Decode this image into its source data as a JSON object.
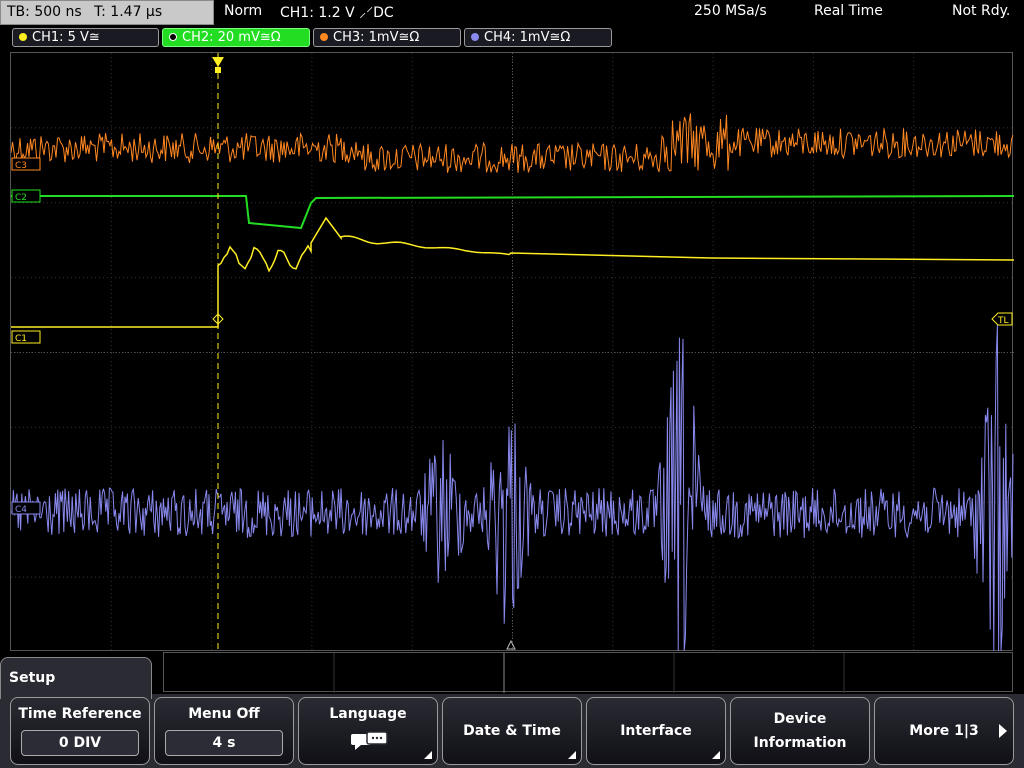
{
  "status": {
    "timebase": "TB: 500 ns",
    "trigger_time": "T: 1.47 µs",
    "mode": "Norm",
    "trigger": "CH1: 1.2 V ⸝⸍DC",
    "sample_rate": "250 MSa/s",
    "acq_mode": "Real Time",
    "state": "Not Rdy."
  },
  "channels": [
    {
      "label": "CH1: 5 V≅",
      "color": "#ffee22"
    },
    {
      "label": "CH2: 20 mV≅Ω",
      "color": "#22dd22"
    },
    {
      "label": "CH3: 1mV≅Ω",
      "color": "#ff8822"
    },
    {
      "label": "CH4: 1mV≅Ω",
      "color": "#8888ee"
    }
  ],
  "markers": {
    "c3": "C3",
    "c2": "C2",
    "c1": "C1",
    "c4": "C4",
    "trigger_level": "TL"
  },
  "menu": {
    "title": "Setup",
    "time_reference": {
      "label": "Time Reference",
      "value": "0 DIV"
    },
    "menu_off": {
      "label": "Menu Off",
      "value": "4 s"
    },
    "language": {
      "label": "Language",
      "icon": "language-icon"
    },
    "date_time": {
      "label": "Date & Time"
    },
    "interface": {
      "label": "Interface"
    },
    "device_info": {
      "label": "Device Information"
    },
    "more": {
      "label": "More 1|3"
    }
  }
}
